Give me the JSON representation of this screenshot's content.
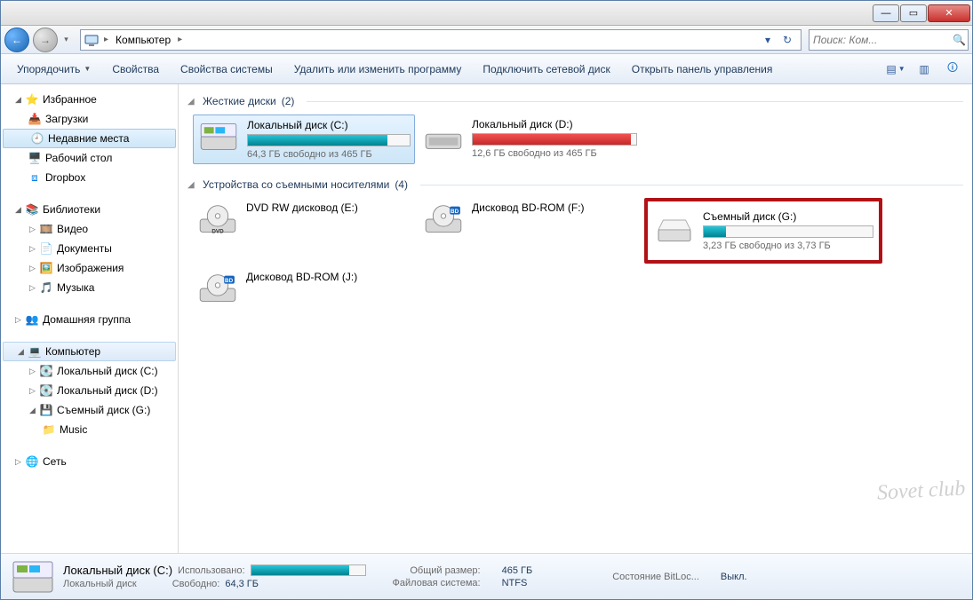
{
  "titlebar": {
    "blurred_text": ""
  },
  "nav": {
    "location": "Компьютер",
    "search_placeholder": "Поиск: Ком..."
  },
  "toolbar": {
    "organize": "Упорядочить",
    "properties": "Свойства",
    "system_properties": "Свойства системы",
    "change_program": "Удалить или изменить программу",
    "map_drive": "Подключить сетевой диск",
    "control_panel": "Открыть панель управления"
  },
  "sidebar": {
    "favorites": {
      "label": "Избранное",
      "items": [
        {
          "icon": "download",
          "label": "Загрузки"
        },
        {
          "icon": "recent",
          "label": "Недавние места",
          "selected": true
        },
        {
          "icon": "desktop",
          "label": "Рабочий стол"
        },
        {
          "icon": "dropbox",
          "label": "Dropbox"
        }
      ]
    },
    "libraries": {
      "label": "Библиотеки",
      "items": [
        {
          "icon": "video",
          "label": "Видео"
        },
        {
          "icon": "document",
          "label": "Документы"
        },
        {
          "icon": "image",
          "label": "Изображения"
        },
        {
          "icon": "music",
          "label": "Музыка"
        }
      ]
    },
    "homegroup": {
      "label": "Домашняя группа"
    },
    "computer": {
      "label": "Компьютер",
      "items": [
        {
          "icon": "hdd",
          "label": "Локальный диск (C:)"
        },
        {
          "icon": "hdd",
          "label": "Локальный диск (D:)"
        },
        {
          "icon": "usb",
          "label": "Съемный диск (G:)",
          "expanded": true,
          "children": [
            {
              "icon": "folder",
              "label": "Music"
            }
          ]
        }
      ]
    },
    "network": {
      "label": "Сеть"
    }
  },
  "main": {
    "hdd_section": {
      "title": "Жесткие диски",
      "count": "(2)"
    },
    "removable_section": {
      "title": "Устройства со съемными носителями",
      "count": "(4)"
    },
    "drives": {
      "c": {
        "name": "Локальный диск (C:)",
        "status": "64,3 ГБ свободно из 465 ГБ",
        "fill_pct": 86,
        "color": "teal",
        "selected": true
      },
      "d": {
        "name": "Локальный диск (D:)",
        "status": "12,6 ГБ свободно из 465 ГБ",
        "fill_pct": 97,
        "color": "red"
      },
      "dvd": {
        "name": "DVD RW дисковод (E:)"
      },
      "bd_f": {
        "name": "Дисковод BD-ROM (F:)"
      },
      "g": {
        "name": "Съемный диск (G:)",
        "status": "3,23 ГБ свободно из 3,73 ГБ",
        "fill_pct": 13,
        "color": "teal",
        "highlighted": true
      },
      "bd_j": {
        "name": "Дисковод BD-ROM (J:)"
      }
    }
  },
  "details": {
    "title": "Локальный диск (C:)",
    "subtitle": "Локальный диск",
    "used_label": "Использовано:",
    "free_label": "Свободно:",
    "free_value": "64,3 ГБ",
    "total_label": "Общий размер:",
    "total_value": "465 ГБ",
    "fs_label": "Файловая система:",
    "fs_value": "NTFS",
    "bitlocker_label": "Состояние BitLoc...",
    "bitlocker_value": "Выкл.",
    "bar_pct": 86
  },
  "watermark": "Sovet club"
}
